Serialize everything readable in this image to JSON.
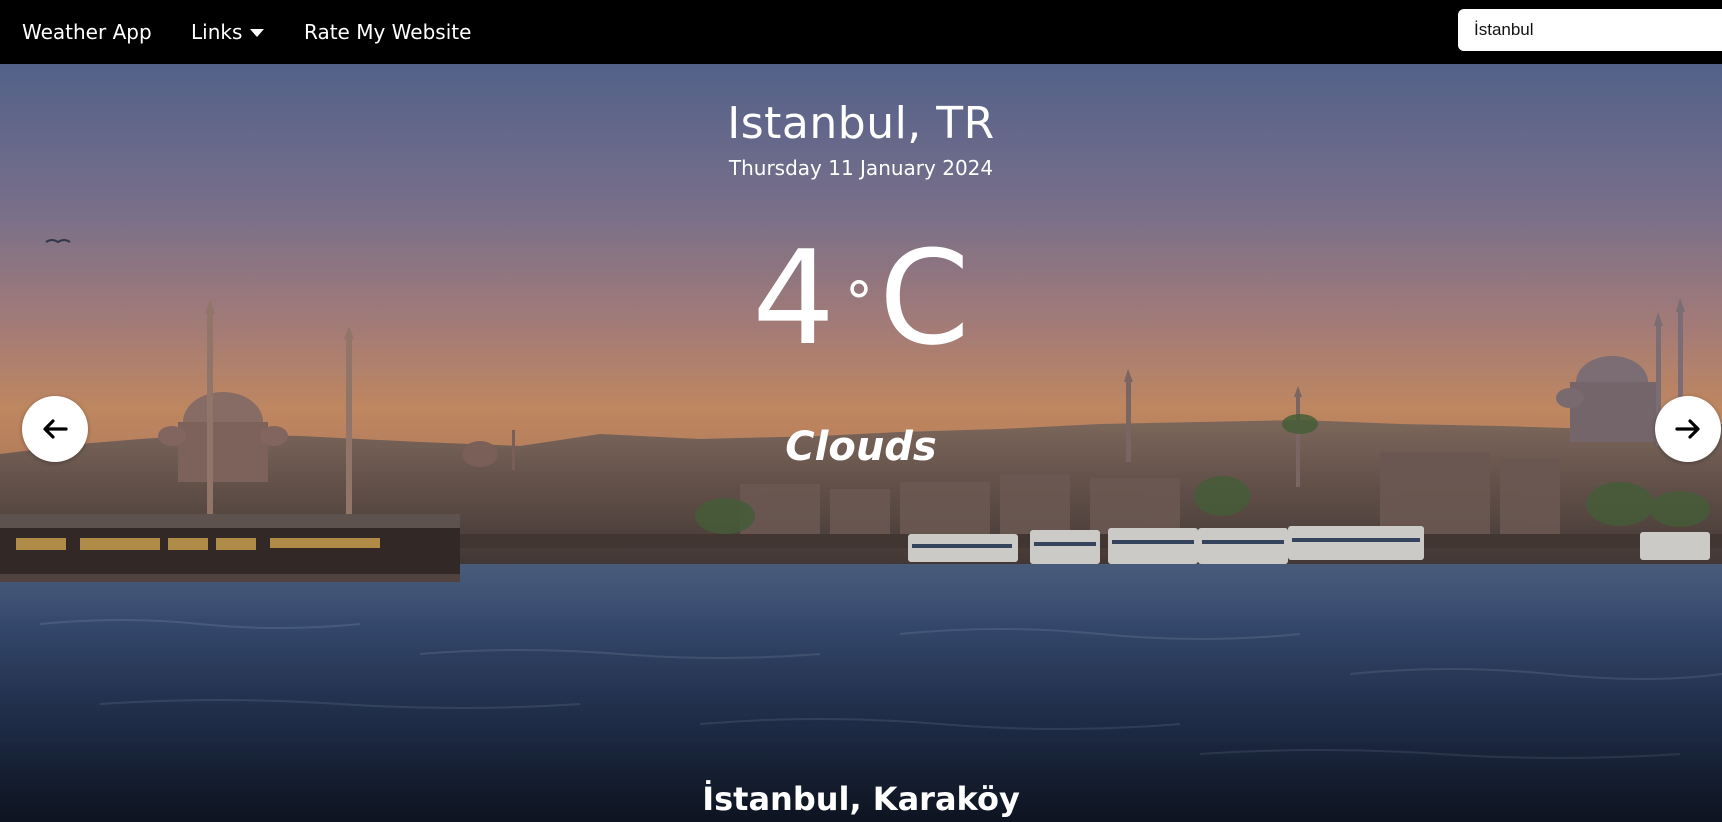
{
  "navbar": {
    "brand": "Weather App",
    "links_label": "Links",
    "rate_label": "Rate My Website",
    "search": {
      "value": "İstanbul",
      "placeholder": ""
    }
  },
  "weather": {
    "city": "Istanbul, TR",
    "date": "Thursday 11 January 2024",
    "temperature": "4",
    "degree_symbol": "°",
    "unit": "C",
    "condition": "Clouds"
  },
  "slide": {
    "caption": "İstanbul, Karaköy"
  },
  "controls": {
    "prev_icon": "arrow-left-icon",
    "next_icon": "arrow-right-icon"
  },
  "colors": {
    "navbar_bg": "#000000",
    "text": "#ffffff",
    "sky_top": "#5f6f9c",
    "sky_mid": "#a98a9a",
    "sky_horizon": "#d89a72",
    "water": "#36507a"
  }
}
